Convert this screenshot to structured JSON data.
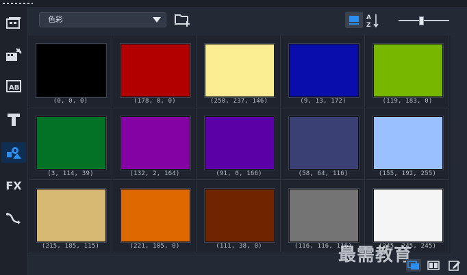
{
  "toolbar": {
    "category_value": "色彩",
    "sort_label": "A Z"
  },
  "sidebar": {
    "items": [
      {
        "name": "media-icon"
      },
      {
        "name": "instant-project-icon"
      },
      {
        "name": "title-ab-icon"
      },
      {
        "name": "text-t-icon"
      },
      {
        "name": "graphics-icon",
        "active": true
      },
      {
        "name": "fx-icon",
        "label": "FX"
      },
      {
        "name": "path-icon"
      }
    ]
  },
  "colors": [
    {
      "label": "(0, 0, 0)",
      "hex": "#000000"
    },
    {
      "label": "(178, 0, 0)",
      "hex": "#b20000"
    },
    {
      "label": "(250, 237, 146)",
      "hex": "#faed92"
    },
    {
      "label": "(9, 13, 172)",
      "hex": "#090dac"
    },
    {
      "label": "(119, 183, 0)",
      "hex": "#77b700"
    },
    {
      "label": "(3, 114, 39)",
      "hex": "#037227"
    },
    {
      "label": "(132, 2, 164)",
      "hex": "#8402a4"
    },
    {
      "label": "(91, 0, 166)",
      "hex": "#5b00a6"
    },
    {
      "label": "(58, 64, 116)",
      "hex": "#3a4074"
    },
    {
      "label": "(155, 192, 255)",
      "hex": "#9bc0ff"
    },
    {
      "label": "(215, 185, 115)",
      "hex": "#d7b973"
    },
    {
      "label": "(221, 105, 0)",
      "hex": "#dd6900"
    },
    {
      "label": "(111, 38, 0)",
      "hex": "#6f2600"
    },
    {
      "label": "(116, 116, 116)",
      "hex": "#747474"
    },
    {
      "label": "(245, 245, 245)",
      "hex": "#f5f5f5"
    }
  ],
  "watermark": "最需教育",
  "accent": "#1f7ad6"
}
